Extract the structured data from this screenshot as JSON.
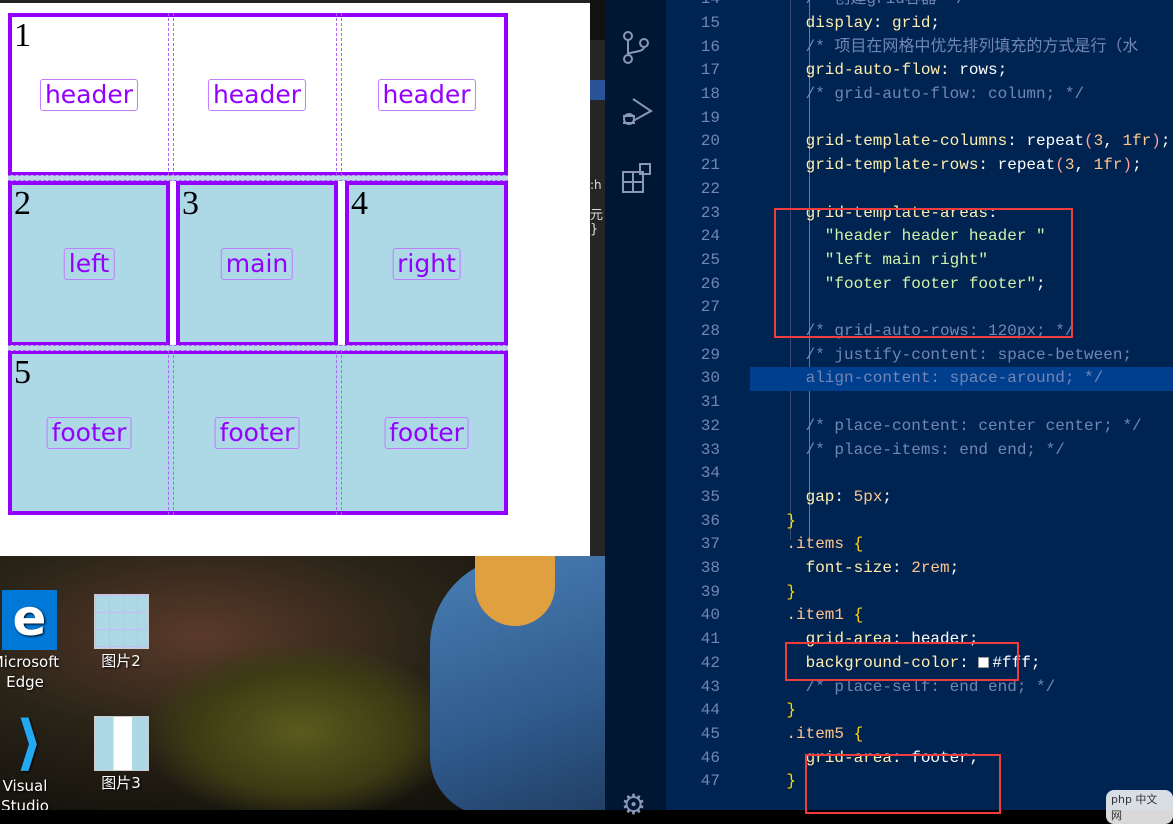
{
  "browser": {
    "rows": [
      {
        "num": "1",
        "labels": [
          "header",
          "header",
          "header"
        ],
        "bg": "#ffffff"
      },
      {
        "nums": [
          "2",
          "3",
          "4"
        ],
        "labels": [
          "left",
          "main",
          "right"
        ],
        "bg": "#add8e6"
      },
      {
        "num": "5",
        "labels": [
          "footer",
          "footer",
          "footer"
        ],
        "bg": "#add8e6"
      }
    ],
    "border_color": "#9400ff"
  },
  "devtools_fragments": {
    "glyph1": "元",
    "glyph2": "}",
    "glyph3": ":h"
  },
  "desktop": {
    "icons": [
      {
        "label": "Microsoft Edge",
        "icon": "edge-icon"
      },
      {
        "label": "图片2",
        "icon": "image-thumbnail-icon"
      },
      {
        "label": "Visual Studio Code",
        "icon": "vscode-icon"
      },
      {
        "label": "图片3",
        "icon": "image-thumbnail-icon"
      }
    ]
  },
  "activity_bar": {
    "icons": [
      "source-control-icon",
      "run-debug-icon",
      "extensions-icon",
      "settings-gear-icon"
    ]
  },
  "editor": {
    "first_line": 13,
    "current_line": 30,
    "lines": [
      [],
      [
        [
          6,
          "c",
          "/* 创建grid容器 */"
        ]
      ],
      [
        [
          6,
          "p",
          "display"
        ],
        [
          0,
          "v",
          ": "
        ],
        [
          0,
          "p",
          "grid"
        ],
        [
          0,
          "v",
          ";"
        ]
      ],
      [
        [
          6,
          "c",
          "/* 项目在网格中优先排列填充的方式是行（水"
        ]
      ],
      [
        [
          6,
          "p",
          "grid-auto-flow"
        ],
        [
          0,
          "v",
          ": rows;"
        ]
      ],
      [
        [
          6,
          "c",
          "/* grid-auto-flow: column; */"
        ]
      ],
      [],
      [
        [
          6,
          "p",
          "grid-template-columns"
        ],
        [
          0,
          "v",
          ": repeat"
        ],
        [
          0,
          "paren",
          "("
        ],
        [
          0,
          "n",
          "3"
        ],
        [
          0,
          "v",
          ", "
        ],
        [
          0,
          "n",
          "1fr"
        ],
        [
          0,
          "paren",
          ")"
        ],
        [
          0,
          "v",
          ";"
        ]
      ],
      [
        [
          6,
          "p",
          "grid-template-rows"
        ],
        [
          0,
          "v",
          ": repeat"
        ],
        [
          0,
          "paren",
          "("
        ],
        [
          0,
          "n",
          "3"
        ],
        [
          0,
          "v",
          ", "
        ],
        [
          0,
          "n",
          "1fr"
        ],
        [
          0,
          "paren",
          ")"
        ],
        [
          0,
          "v",
          ";"
        ]
      ],
      [],
      [
        [
          6,
          "p",
          "grid-template-areas"
        ],
        [
          0,
          "v",
          ":"
        ]
      ],
      [
        [
          8,
          "s",
          "\"header header header \""
        ]
      ],
      [
        [
          8,
          "s",
          "\"left main right\""
        ]
      ],
      [
        [
          8,
          "s",
          "\"footer footer footer\""
        ],
        [
          0,
          "v",
          ";"
        ]
      ],
      [],
      [
        [
          6,
          "c",
          "/* grid-auto-rows: 120px; */"
        ]
      ],
      [
        [
          6,
          "c",
          "/* justify-content: space-between;"
        ]
      ],
      [
        [
          6,
          "c",
          "align-content: space-around; */"
        ]
      ],
      [],
      [
        [
          6,
          "c",
          "/* place-content: center center; */"
        ]
      ],
      [
        [
          6,
          "c",
          "/* place-items: end end; */"
        ]
      ],
      [],
      [
        [
          6,
          "p",
          "gap"
        ],
        [
          0,
          "v",
          ": "
        ],
        [
          0,
          "n",
          "5px"
        ],
        [
          0,
          "v",
          ";"
        ]
      ],
      [
        [
          4,
          "b",
          "}"
        ]
      ],
      [
        [
          4,
          "sel",
          ".items"
        ],
        [
          0,
          "b",
          " {"
        ]
      ],
      [
        [
          6,
          "p",
          "font-size"
        ],
        [
          0,
          "v",
          ": "
        ],
        [
          0,
          "n",
          "2rem"
        ],
        [
          0,
          "v",
          ";"
        ]
      ],
      [
        [
          4,
          "b",
          "}"
        ]
      ],
      [
        [
          4,
          "sel",
          ".item1"
        ],
        [
          0,
          "b",
          " {"
        ]
      ],
      [
        [
          6,
          "p",
          "grid-area"
        ],
        [
          0,
          "v",
          ": header;"
        ]
      ],
      [
        [
          6,
          "p",
          "background-color"
        ],
        [
          0,
          "v",
          ": "
        ],
        [
          0,
          "swatch",
          ""
        ],
        [
          0,
          "v",
          "#fff;"
        ]
      ],
      [
        [
          6,
          "c",
          "/* place-self: end end; */"
        ]
      ],
      [
        [
          4,
          "b",
          "}"
        ]
      ],
      [
        [
          4,
          "sel",
          ".item5"
        ],
        [
          0,
          "b",
          " {"
        ]
      ],
      [
        [
          6,
          "p",
          "grid-area"
        ],
        [
          0,
          "v",
          ": footer;"
        ]
      ],
      [
        [
          4,
          "b",
          "}"
        ]
      ]
    ]
  },
  "watermark": "php 中文网"
}
